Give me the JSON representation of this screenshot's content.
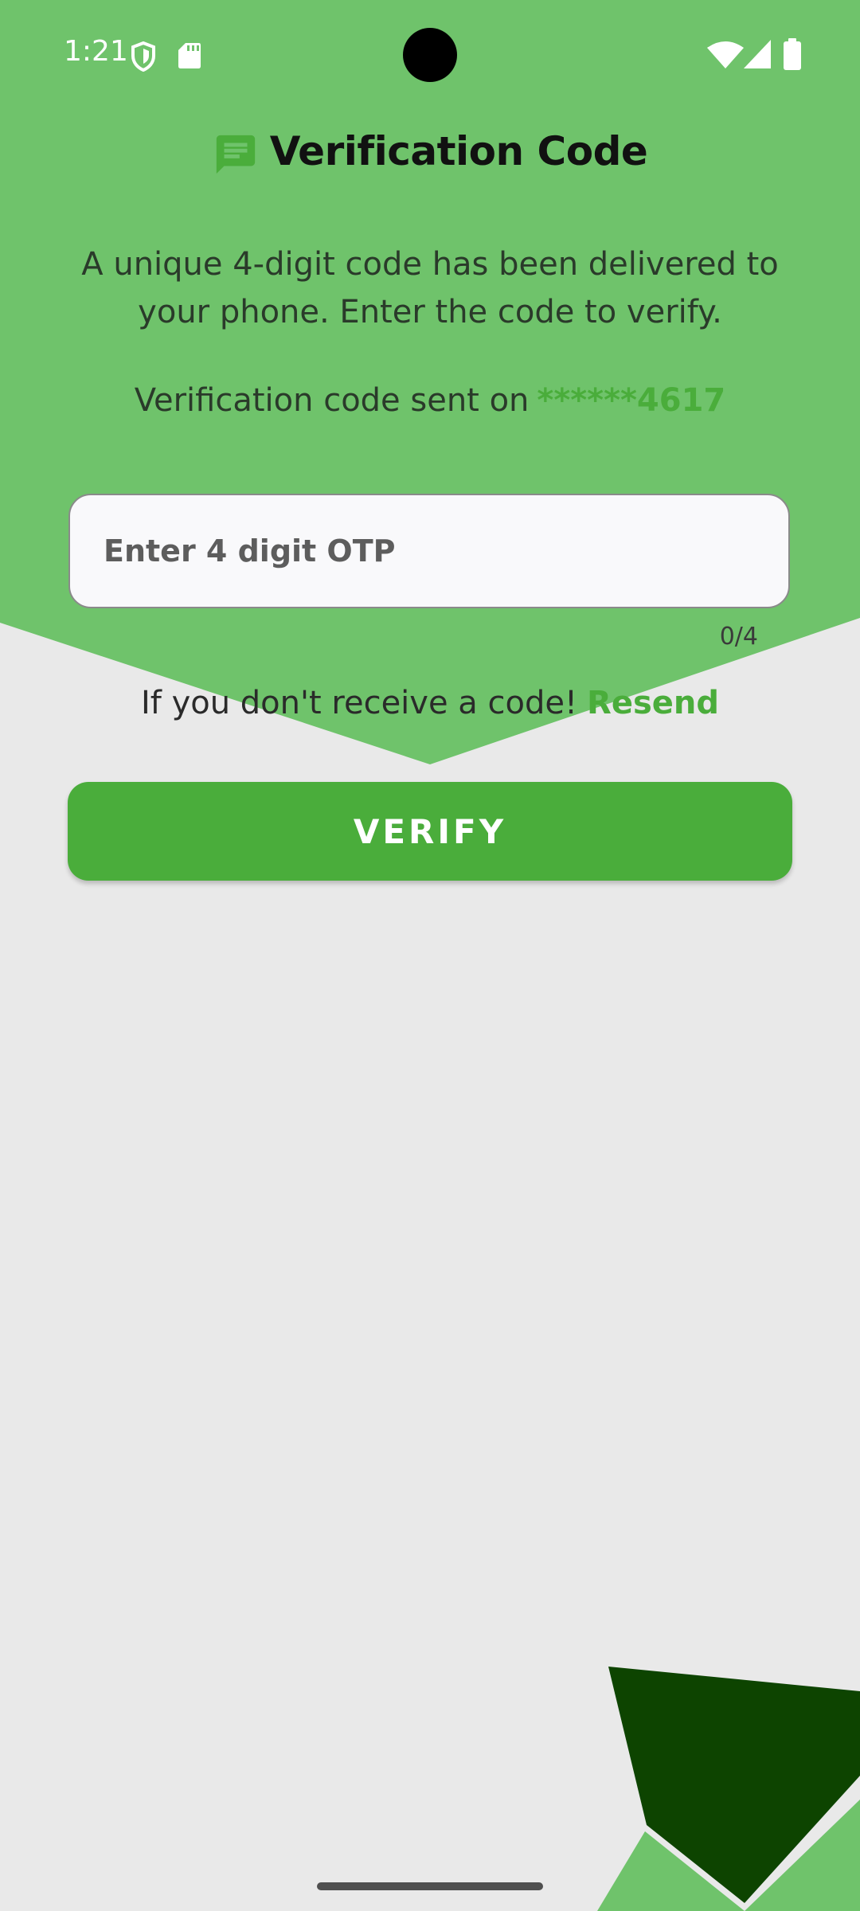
{
  "colors": {
    "header_green": "#6fc36b",
    "accent_green": "#4aad3b",
    "dark_green": "#0d4400",
    "background": "#e9e9e9"
  },
  "status_bar": {
    "time": "1:21",
    "icons": [
      "shield-icon",
      "sd-card-icon",
      "wifi-icon",
      "cellular-signal-icon",
      "battery-icon"
    ]
  },
  "header": {
    "icon": "message-icon",
    "title": "Verification Code"
  },
  "description": "A unique 4-digit code has been delivered to your phone. Enter the code to verify.",
  "sent_info": {
    "label": "Verification code sent on",
    "masked_phone": "******4617"
  },
  "otp": {
    "placeholder": "Enter 4 digit OTP",
    "value": "",
    "counter": "0/4"
  },
  "resend": {
    "text": "If you don't receive a code!",
    "link": "Resend"
  },
  "verify_button": {
    "label": "VERIFY"
  }
}
